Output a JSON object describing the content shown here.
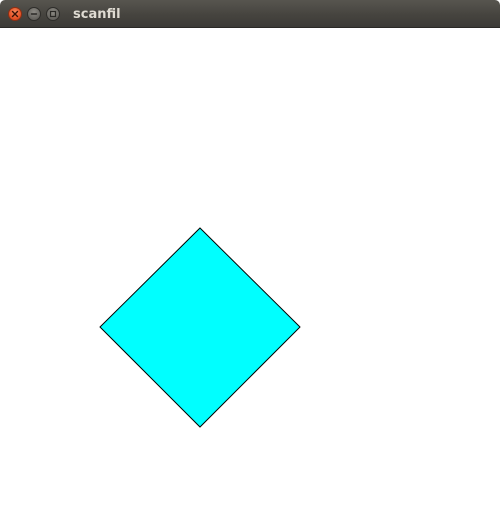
{
  "window": {
    "title": "scanfil",
    "controls": [
      {
        "name": "close",
        "icon": "close-icon"
      },
      {
        "name": "minimize",
        "icon": "minimize-icon"
      },
      {
        "name": "maximize",
        "icon": "maximize-icon"
      }
    ]
  },
  "drawing": {
    "shape": "diamond",
    "fill_color": "#00ffff",
    "outline_color": "#000000"
  }
}
